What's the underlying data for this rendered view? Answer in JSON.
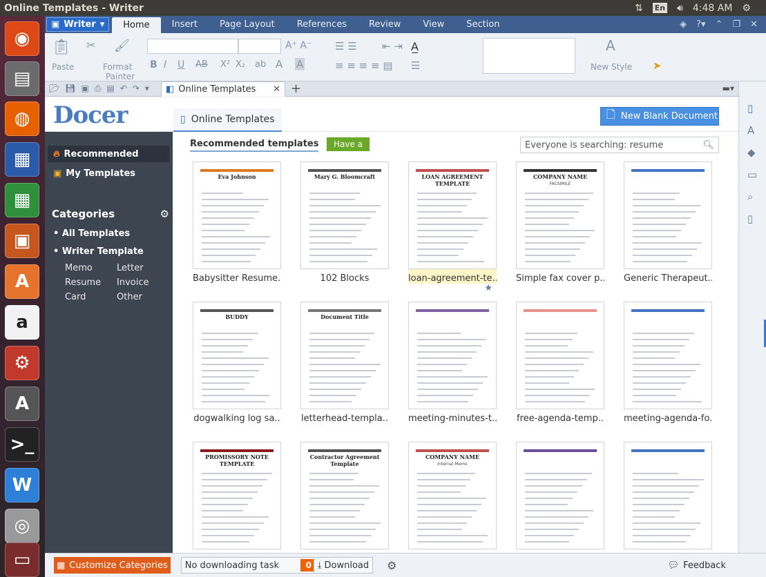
{
  "window_title": "Online Templates - Writer",
  "tray": {
    "lang": "En",
    "time": "4:48 AM"
  },
  "menubar": {
    "app_button": "Writer",
    "tabs": [
      "Home",
      "Insert",
      "Page Layout",
      "References",
      "Review",
      "View",
      "Section"
    ],
    "active_tab": "Home"
  },
  "ribbon": {
    "paste": "Paste",
    "format_painter_1": "Format",
    "format_painter_2": "Painter",
    "new_style": "New Style"
  },
  "doctab": {
    "label": "Online Templates"
  },
  "docer": {
    "logo": "Docer",
    "tab": "Online Templates",
    "new_blank": "New Blank Document"
  },
  "sidebar": {
    "recommended": "Recommended",
    "my_templates": "My Templates",
    "categories": "Categories",
    "all_templates": "All Templates",
    "writer_template": "Writer Template",
    "subcats": [
      "Memo",
      "Letter",
      "Resume",
      "Invoice",
      "Card",
      "Other"
    ]
  },
  "main": {
    "rec_title": "Recommended templates",
    "have_a_try": "Have a try",
    "search_text": "Everyone is searching: resume",
    "templates": [
      {
        "name": "Babysitter Resume.."
      },
      {
        "name": "102 Blocks"
      },
      {
        "name": "loan-agreement-te.."
      },
      {
        "name": "Simple fax cover p.."
      },
      {
        "name": "Generic Therapeut.."
      },
      {
        "name": "dogwalking log sa.."
      },
      {
        "name": "letterhead-templa.."
      },
      {
        "name": "meeting-minutes-t.."
      },
      {
        "name": "free-agenda-temp.."
      },
      {
        "name": "meeting-agenda-fo.."
      },
      {
        "name": ""
      },
      {
        "name": ""
      },
      {
        "name": ""
      },
      {
        "name": ""
      },
      {
        "name": ""
      }
    ],
    "thumb_text": {
      "t1": "Eva Johnson",
      "t2": "Mary G. Bloomcraft",
      "t3": "LOAN AGREEMENT TEMPLATE",
      "t4": "COMPANY NAME",
      "t4b": "FACSIMILE",
      "t6": "BUDDY",
      "t7": "Document Title",
      "t11": "PROMISSORY NOTE TEMPLATE",
      "t12": "Contractor Agreement Template",
      "t13": "COMPANY NAME",
      "t13b": "Internal Memo"
    }
  },
  "statusbar": {
    "customize": "Customize Categories",
    "no_task": "No downloading task",
    "count": "0",
    "download": "Download",
    "feedback": "Feedback"
  }
}
